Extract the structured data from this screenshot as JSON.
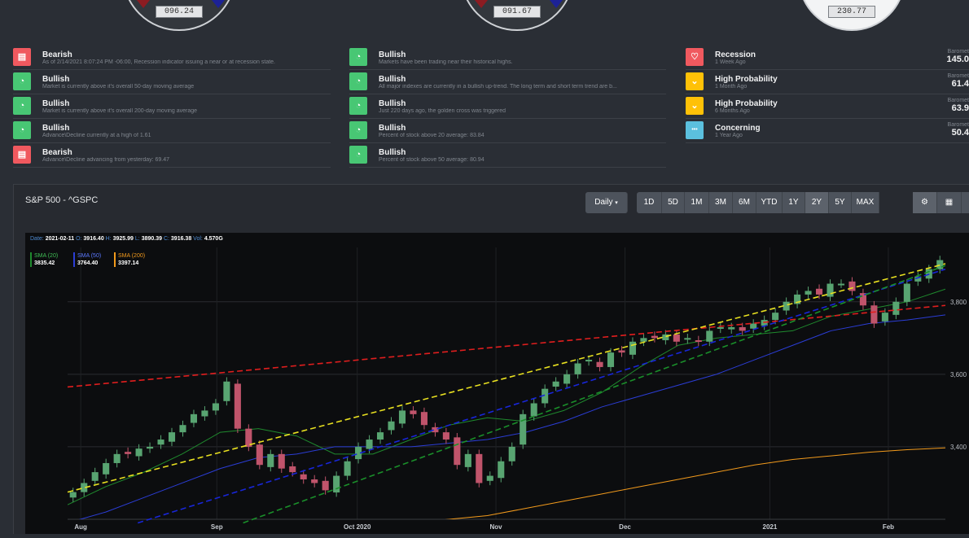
{
  "gauges": [
    {
      "value": "096.24",
      "theme": "dark"
    },
    {
      "value": "091.67",
      "theme": "dark"
    },
    {
      "value": "230.77",
      "theme": "light"
    }
  ],
  "indicators": {
    "column1": [
      {
        "status": "Bearish",
        "desc": "As of 2/14/2021 8:07:24 PM -06:00, Recession indicator issuing a near or at recession state.",
        "color": "#f0595f",
        "icon": "message-icon"
      },
      {
        "status": "Bullish",
        "desc": "Market is currently above it's overall 50-day moving average",
        "color": "#48c774",
        "icon": "speedometer-icon"
      },
      {
        "status": "Bullish",
        "desc": "Market is currently above it's overall 200-day moving average",
        "color": "#48c774",
        "icon": "speedometer-icon"
      },
      {
        "status": "Bullish",
        "desc": "Advance\\Decline currently at a high of 1.61",
        "color": "#48c774",
        "icon": "speedometer-icon"
      },
      {
        "status": "Bearish",
        "desc": "Advance\\Decline advancing from yesterday: 69.47",
        "color": "#f0595f",
        "icon": "message-icon"
      }
    ],
    "column2": [
      {
        "status": "Bullish",
        "desc": "Markets have been trading near their historical highs.",
        "color": "#48c774",
        "icon": "speedometer-icon"
      },
      {
        "status": "Bullish",
        "desc": "All major indexes are currently in a bullish up-trend. The long term and short term trend are b...",
        "color": "#48c774",
        "icon": "speedometer-icon"
      },
      {
        "status": "Bullish",
        "desc": "Just 220 days ago, the golden cross was triggered",
        "color": "#48c774",
        "icon": "speedometer-icon"
      },
      {
        "status": "Bullish",
        "desc": "Percent of stock above 20 average: 83.84",
        "color": "#48c774",
        "icon": "speedometer-icon"
      },
      {
        "status": "Bullish",
        "desc": "Percent of stock above 50 average: 80.94",
        "color": "#48c774",
        "icon": "speedometer-icon"
      }
    ],
    "column3": [
      {
        "status": "Recession",
        "desc": "1 Week Ago",
        "color": "#f0595f",
        "icon": "chat-warning-icon",
        "baro_label": "Baromet",
        "baro_value": "145.0"
      },
      {
        "status": "High Probability",
        "desc": "1 Month Ago",
        "color": "#ffc107",
        "icon": "chevron-down-icon",
        "baro_label": "Baromet",
        "baro_value": "61.4"
      },
      {
        "status": "High Probability",
        "desc": "6 Months Ago",
        "color": "#ffc107",
        "icon": "chevron-down-icon",
        "baro_label": "Baromet",
        "baro_value": "63.9"
      },
      {
        "status": "Concerning",
        "desc": "1 Year Ago",
        "color": "#5bc0de",
        "icon": "ellipsis-icon",
        "baro_label": "Baromet",
        "baro_value": "50.4"
      }
    ]
  },
  "panel": {
    "title": "S&P 500 - ^GSPC",
    "interval": "Daily",
    "ranges": [
      "1D",
      "5D",
      "1M",
      "3M",
      "6M",
      "YTD",
      "1Y",
      "2Y",
      "5Y",
      "MAX"
    ],
    "active_range": "2Y",
    "tools": [
      "settings-icon",
      "calculator-icon"
    ]
  },
  "chart_header": {
    "date_label": "Date:",
    "date": "2021-02-11",
    "o_label": "O:",
    "o": "3916.40",
    "h_label": "H:",
    "h": "3925.99",
    "l_label": "L:",
    "l": "3890.39",
    "c_label": "C:",
    "c": "3916.38",
    "vol_label": "Vol:",
    "vol": "4.570G"
  },
  "sma_legend": [
    {
      "name": "SMA (20)",
      "value": "3835.42",
      "color": "#1f8a2e"
    },
    {
      "name": "SMA (50)",
      "value": "3764.40",
      "color": "#2b3dd6"
    },
    {
      "name": "SMA (200)",
      "value": "3397.14",
      "color": "#f29a1c"
    }
  ],
  "chart_data": {
    "type": "line",
    "x_ticks": [
      "Aug",
      "Sep",
      "Oct 2020",
      "Nov",
      "Dec",
      "2021",
      "Feb"
    ],
    "y_ticks": [
      3400,
      3600,
      3800
    ],
    "y_tick_labels": [
      "3,400",
      "3,600",
      "3,800"
    ],
    "ylim": [
      3200,
      3950
    ],
    "series": [
      {
        "name": "SMA (20)",
        "color": "#1f8a2e",
        "values": [
          3240,
          3290,
          3330,
          3380,
          3440,
          3450,
          3430,
          3380,
          3380,
          3420,
          3460,
          3480,
          3470,
          3500,
          3550,
          3620,
          3680,
          3700,
          3710,
          3720,
          3760,
          3780,
          3800,
          3835
        ]
      },
      {
        "name": "SMA (50)",
        "color": "#2b3dd6",
        "values": [
          3190,
          3220,
          3260,
          3300,
          3340,
          3370,
          3380,
          3400,
          3400,
          3400,
          3410,
          3420,
          3440,
          3470,
          3510,
          3540,
          3570,
          3600,
          3640,
          3680,
          3720,
          3740,
          3750,
          3764
        ]
      },
      {
        "name": "SMA (200)",
        "color": "#f29a1c",
        "values": [
          3100,
          3110,
          3120,
          3130,
          3140,
          3150,
          3160,
          3170,
          3180,
          3190,
          3200,
          3210,
          3230,
          3250,
          3270,
          3290,
          3310,
          3330,
          3350,
          3365,
          3375,
          3385,
          3392,
          3397
        ]
      }
    ],
    "candles": {
      "close": [
        3275,
        3300,
        3330,
        3355,
        3380,
        3380,
        3395,
        3400,
        3420,
        3440,
        3460,
        3490,
        3500,
        3520,
        3580,
        3450,
        3400,
        3350,
        3380,
        3340,
        3330,
        3310,
        3300,
        3280,
        3320,
        3360,
        3400,
        3420,
        3440,
        3470,
        3500,
        3490,
        3460,
        3440,
        3420,
        3350,
        3380,
        3300,
        3320,
        3360,
        3400,
        3490,
        3520,
        3560,
        3580,
        3600,
        3630,
        3640,
        3620,
        3660,
        3660,
        3690,
        3700,
        3700,
        3710,
        3690,
        3700,
        3690,
        3720,
        3730,
        3730,
        3720,
        3740,
        3750,
        3770,
        3800,
        3820,
        3830,
        3820,
        3850,
        3850,
        3830,
        3790,
        3740,
        3770,
        3800,
        3850,
        3870,
        3890,
        3915
      ]
    },
    "trendlines": [
      {
        "color": "#e01e1e",
        "style": "dashed",
        "from": [
          0,
          3565
        ],
        "to": [
          1,
          3790
        ]
      },
      {
        "color": "#e8e020",
        "style": "dashed",
        "from": [
          0,
          3275
        ],
        "to": [
          1,
          3905
        ]
      },
      {
        "color": "#1826d8",
        "style": "dashed",
        "from": [
          0.08,
          3190
        ],
        "to": [
          1,
          3890
        ]
      },
      {
        "color": "#1a8f2a",
        "style": "dashed",
        "from": [
          0.2,
          3190
        ],
        "to": [
          1,
          3900
        ]
      }
    ]
  }
}
